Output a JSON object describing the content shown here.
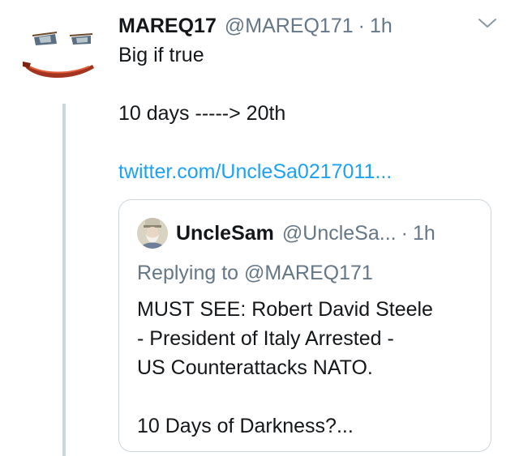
{
  "tweet": {
    "name": "MAREQ17",
    "handle": "@MAREQ171",
    "separator": "·",
    "time": "1h",
    "text_lines": [
      "Big if true",
      "",
      "10 days -----> 20th"
    ],
    "link": "twitter.com/UncleSa0217011..."
  },
  "quote": {
    "name": "UncleSam",
    "handle": "@UncleSa...",
    "separator": "·",
    "time": "1h",
    "replying_prefix": "Replying to ",
    "replying_to": "@MAREQ171",
    "body_lines": [
      "MUST SEE: Robert David Steele",
      "- President of Italy Arrested -",
      "US Counterattacks NATO.",
      "",
      "10 Days of Darkness?..."
    ]
  },
  "icons": {
    "menu": "chevron-down-icon",
    "avatar": "joker-face-avatar"
  },
  "colors": {
    "link": "#1da1f2",
    "muted": "#657786",
    "border": "#ccd6dd",
    "text": "#14171a"
  }
}
